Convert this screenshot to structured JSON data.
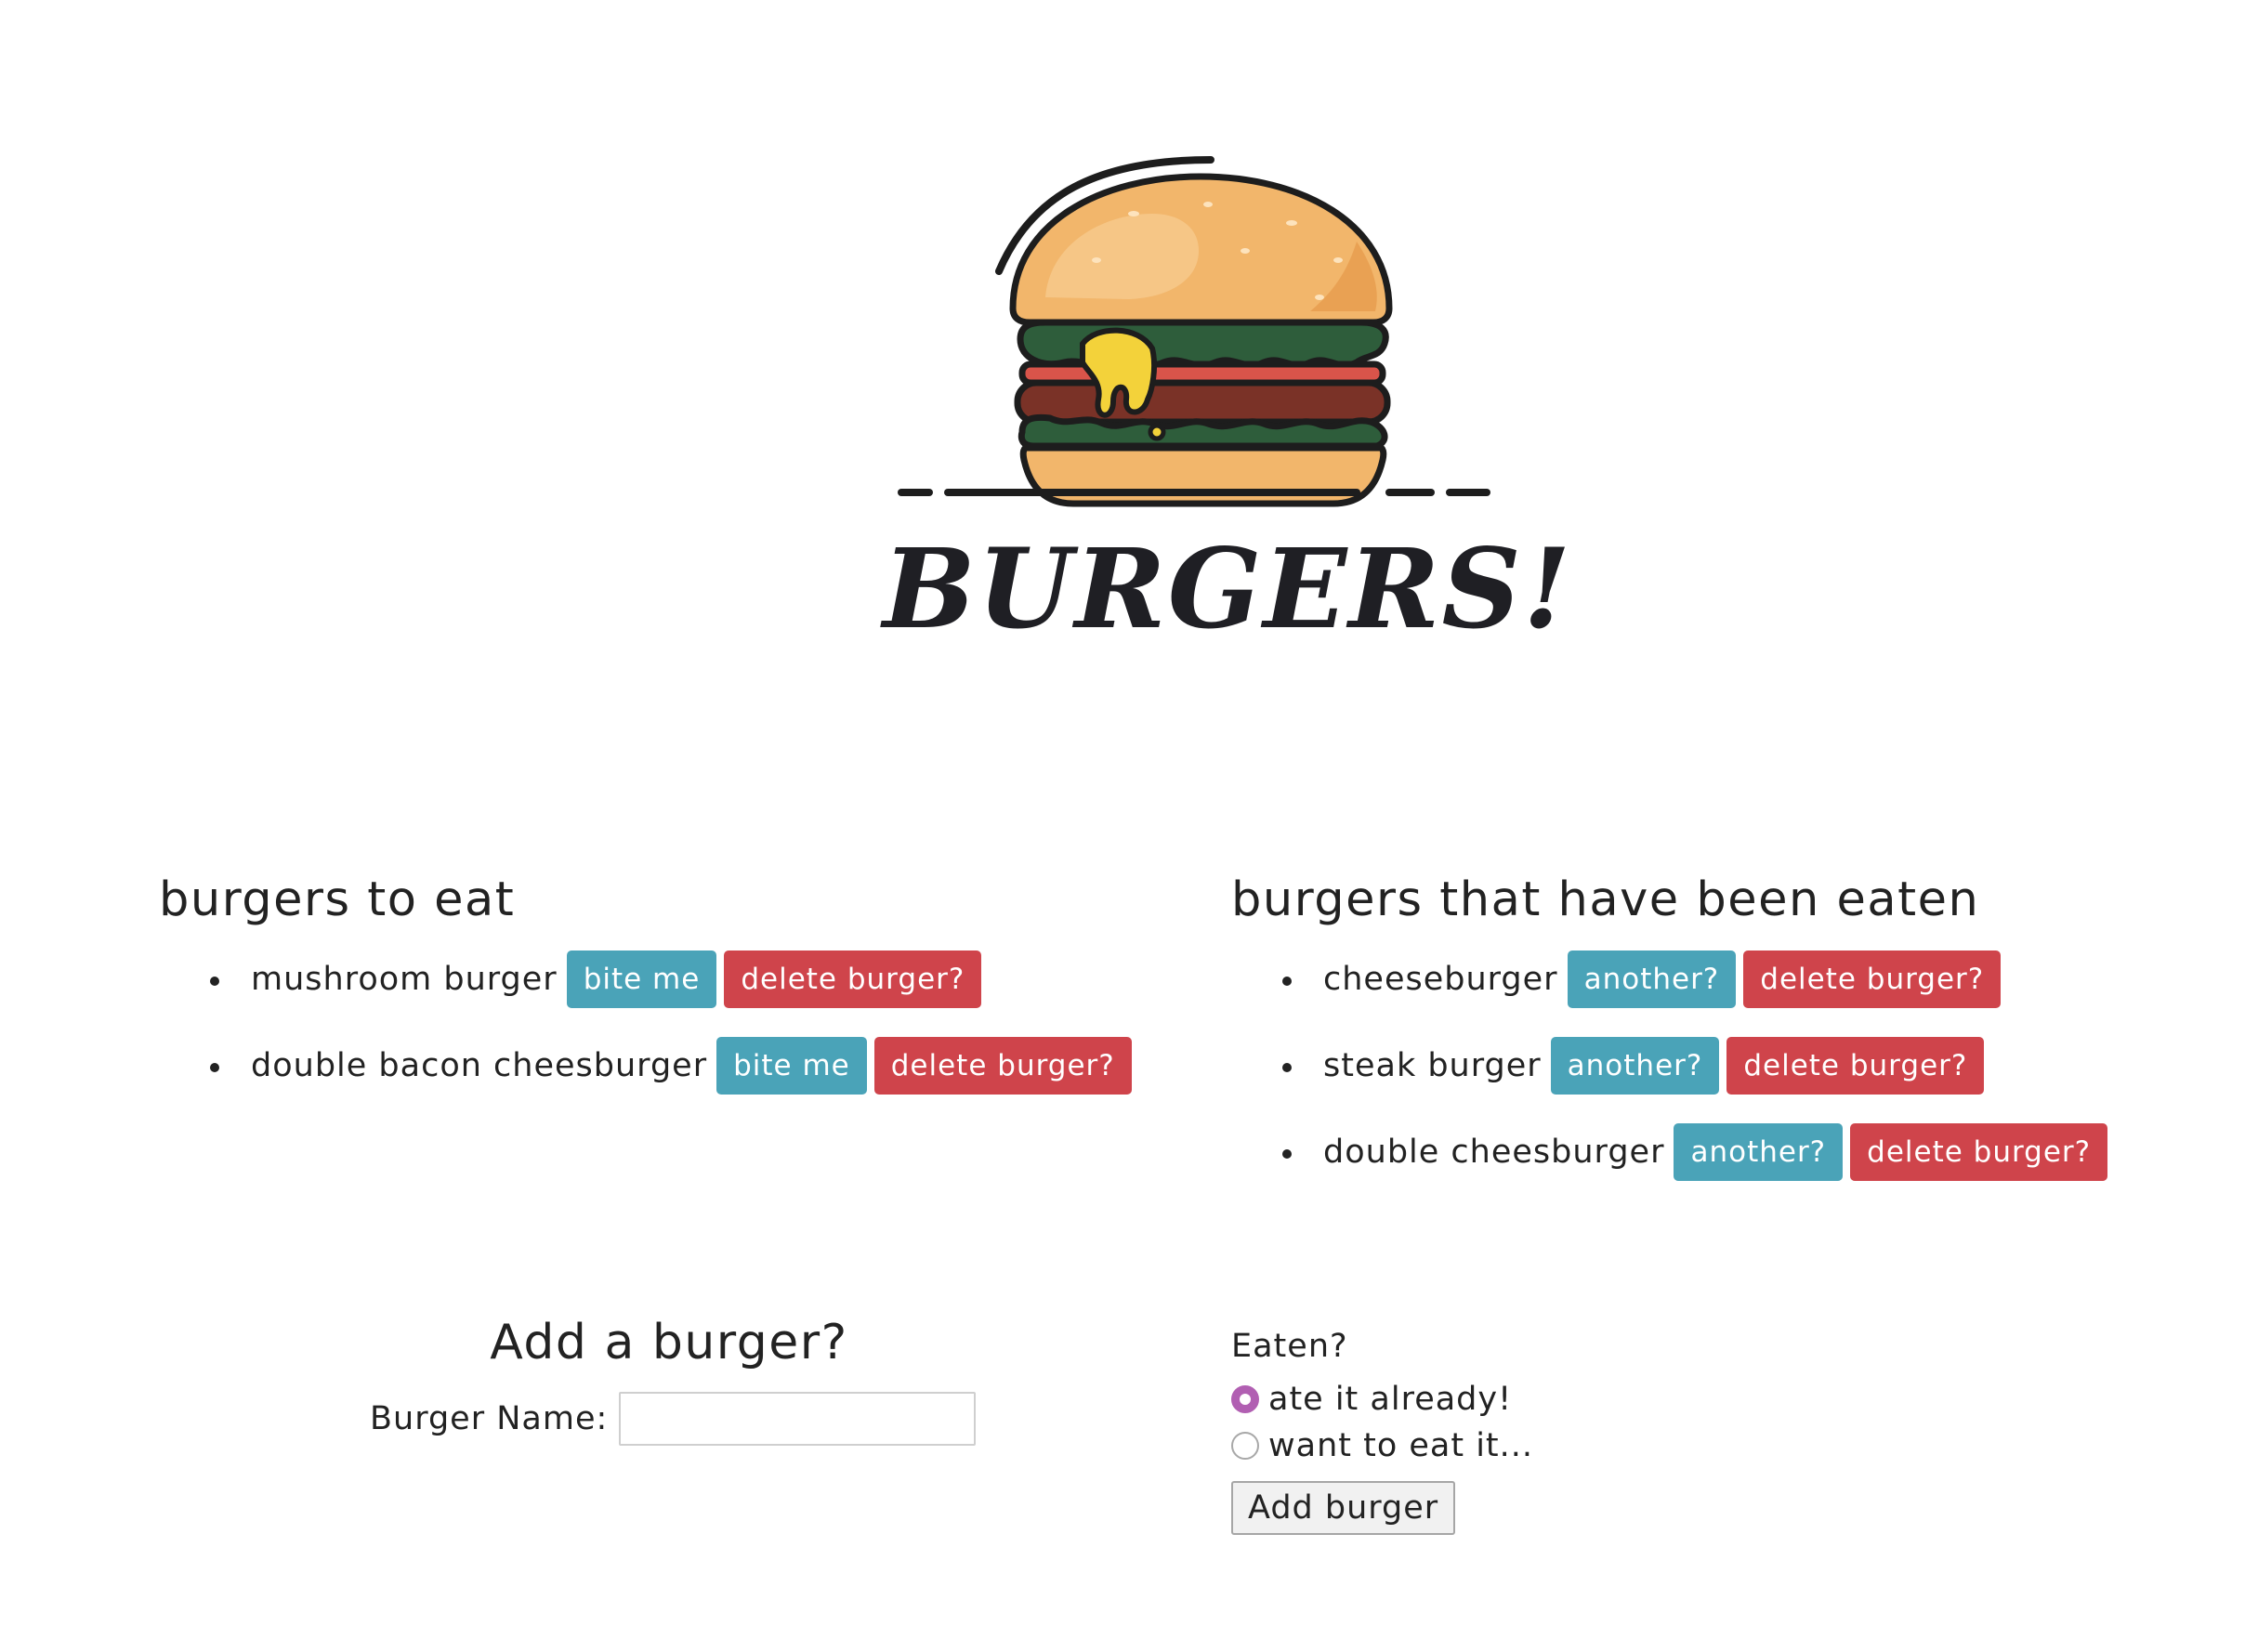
{
  "header": {
    "title": "BURGERS!",
    "logo_icon": "burger-icon"
  },
  "lists": {
    "to_eat": {
      "heading": "burgers to eat",
      "items": [
        {
          "name": "mushroom burger",
          "action_label": "bite me",
          "delete_label": "delete burger?"
        },
        {
          "name": "double bacon cheesburger",
          "action_label": "bite me",
          "delete_label": "delete burger?"
        }
      ]
    },
    "eaten": {
      "heading": "burgers that have been eaten",
      "items": [
        {
          "name": "cheeseburger",
          "action_label": "another?",
          "delete_label": "delete burger?"
        },
        {
          "name": "steak burger",
          "action_label": "another?",
          "delete_label": "delete burger?"
        },
        {
          "name": "double cheesburger",
          "action_label": "another?",
          "delete_label": "delete burger?"
        }
      ]
    }
  },
  "form": {
    "title": "Add a burger?",
    "name_label": "Burger Name:",
    "name_value": "",
    "eaten_label": "Eaten?",
    "options": [
      {
        "label": "ate it already!",
        "checked": true
      },
      {
        "label": "want to eat it...",
        "checked": false
      }
    ],
    "submit_label": "Add burger"
  },
  "colors": {
    "action_button": "#4aa3b8",
    "delete_button": "#cf444b",
    "radio_checked": "#b15fb2"
  }
}
